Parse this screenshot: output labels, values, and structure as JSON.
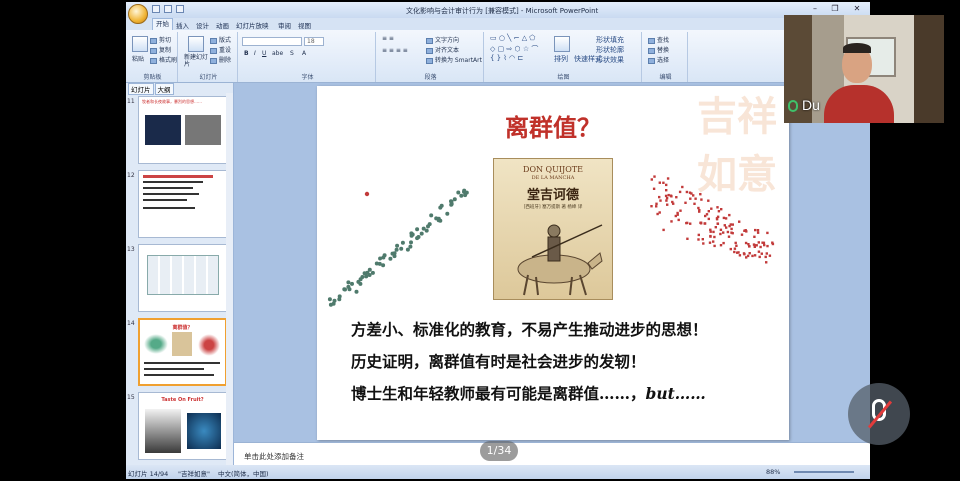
{
  "window": {
    "title": "文化影响与会计审计行为 [兼容模式] - Microsoft PowerPoint",
    "controls": [
      "–",
      "❐",
      "✕"
    ]
  },
  "ribbon": {
    "tabs": [
      "开始",
      "插入",
      "设计",
      "动画",
      "幻灯片放映",
      "审阅",
      "视图"
    ],
    "active_tab": "开始",
    "groups": {
      "clipboard": {
        "label": "剪贴板",
        "paste": "粘贴",
        "cut": "剪切",
        "copy": "复制",
        "format_painter": "格式刷"
      },
      "slides": {
        "label": "幻灯片",
        "new_slide": "新建幻灯片",
        "layout": "版式",
        "reset": "重设",
        "delete": "删除"
      },
      "font": {
        "label": "字体",
        "size": "18"
      },
      "paragraph": {
        "label": "段落",
        "text_direction": "文字方向",
        "align_text": "对齐文本",
        "smartart": "转换为 SmartArt"
      },
      "drawing": {
        "label": "绘图",
        "arrange": "排列",
        "quick_styles": "快速样式",
        "shape_fill": "形状填充",
        "shape_outline": "形状轮廓",
        "shape_effects": "形状效果"
      },
      "editing": {
        "label": "编辑",
        "find": "查找",
        "replace": "替换",
        "select": "选择"
      }
    }
  },
  "left_pane": {
    "tabs": [
      "幻灯片",
      "大纲"
    ],
    "thumbnails": [
      {
        "num": "11",
        "title": "牧者和长夜故事，暴烈的思想……"
      },
      {
        "num": "12",
        "title": ""
      },
      {
        "num": "13",
        "title": ""
      },
      {
        "num": "14",
        "title": "离群值？"
      },
      {
        "num": "15",
        "title": "Taste On Fruit?"
      }
    ]
  },
  "slide": {
    "title": "离群值？",
    "watermark": "吉祥如意",
    "book": {
      "line1": "DON QUIJOTE",
      "line2": "DE LA MANCHA",
      "line3": "堂吉诃德",
      "line4": "[西班牙] 塞万提斯 著  杨绛 译"
    },
    "bullets": [
      "方差小、标准化的教育，不易产生推动进步的思想！",
      "历史证明，离群值有时是社会进步的发轫！",
      "博士生和年轻教师最有可能是离群值……，"
    ],
    "bullet_tail": "but……"
  },
  "notes": {
    "placeholder": "单击此处添加备注"
  },
  "statusbar": {
    "slide_info": "幻灯片 14/94",
    "theme": "\"吉祥如意\"",
    "language": "中文(简体，中国)",
    "zoom": "88%"
  },
  "overlay": {
    "participant_name": "Du",
    "page_counter": "1/34"
  },
  "colors": {
    "title_red": "#c0312a",
    "scatter_left": "#4f7a6c",
    "scatter_right": "#c23a3a"
  }
}
